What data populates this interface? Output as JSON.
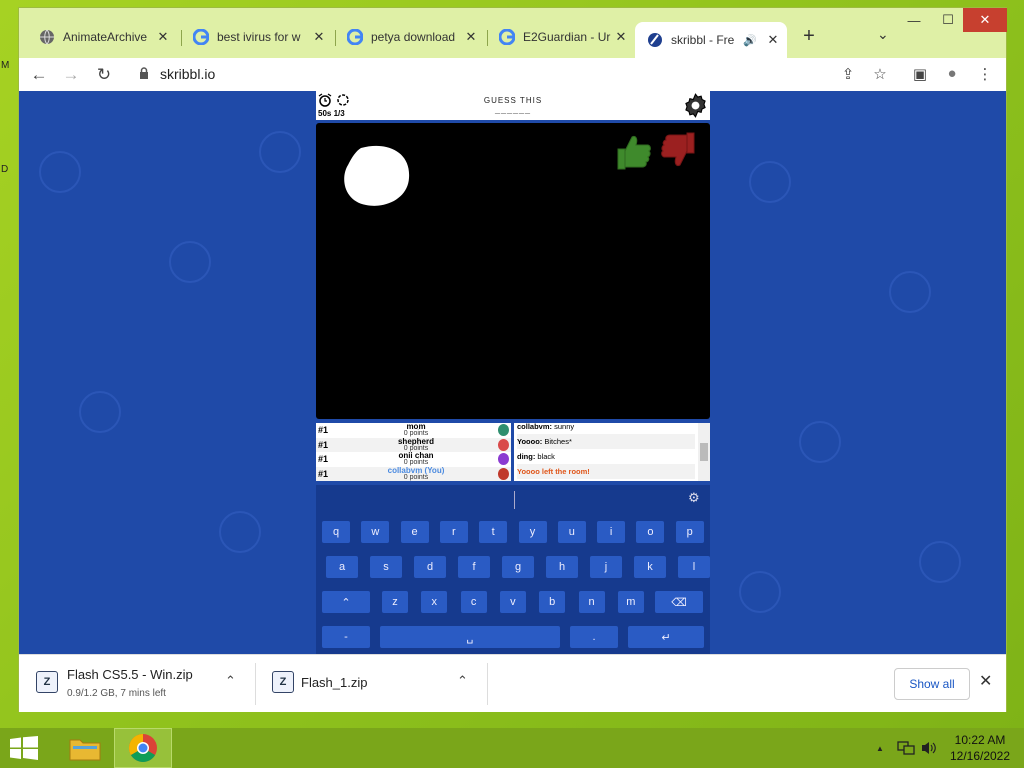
{
  "desktop": {
    "marks": [
      "M",
      "D"
    ]
  },
  "browser": {
    "tabs": [
      {
        "label": "AnimateArchive",
        "icon": "globe-icon",
        "close": "✕"
      },
      {
        "label": "best ivirus for w",
        "icon": "google-icon",
        "close": "✕"
      },
      {
        "label": "petya download",
        "icon": "google-icon",
        "close": "✕"
      },
      {
        "label": "E2Guardian - Ur",
        "icon": "google-icon",
        "close": "✕"
      },
      {
        "label": "skribbl - Fre",
        "icon": "skribbl-icon",
        "close": "✕",
        "active": true
      }
    ],
    "new_tab": "+",
    "tab_search": "⌄",
    "window_controls": {
      "minimize": "—",
      "maximize": "☐",
      "close": "✕"
    },
    "nav": {
      "back": "←",
      "forward": "→",
      "reload": "↻"
    },
    "address": "skribbl.io",
    "toolbar_icons": {
      "share": "⇪",
      "bookmark": "☆",
      "sidepanel": "▣",
      "profile": "●",
      "menu": "⋮"
    }
  },
  "game": {
    "timer": "50s 1/3",
    "guess_label": "GUESS THIS",
    "guess_word": "______",
    "players": [
      {
        "rank": "#1",
        "name": "mom",
        "points": "0 points",
        "color": "#000000",
        "avatar": "#2f8f6f"
      },
      {
        "rank": "#1",
        "name": "shepherd",
        "points": "0 points",
        "color": "#000000",
        "avatar": "#d94a4a"
      },
      {
        "rank": "#1",
        "name": "onii chan",
        "points": "0 points",
        "color": "#000000",
        "avatar": "#8b3bd1"
      },
      {
        "rank": "#1",
        "name": "collabvm (You)",
        "points": "0 points",
        "color": "#4a8ae0",
        "avatar": "#c0392b"
      }
    ],
    "chat": [
      {
        "user": "collabvm:",
        "text": " sunny"
      },
      {
        "user": "Yoooo:",
        "text": " Bitches*"
      },
      {
        "user": "ding:",
        "text": " black"
      },
      {
        "system": "Yoooo left the room!"
      }
    ],
    "keyboard": {
      "row1": [
        "q",
        "w",
        "e",
        "r",
        "t",
        "y",
        "u",
        "i",
        "o",
        "p"
      ],
      "row2": [
        "a",
        "s",
        "d",
        "f",
        "g",
        "h",
        "j",
        "k",
        "l"
      ],
      "row3": [
        "⌃",
        "z",
        "x",
        "c",
        "v",
        "b",
        "n",
        "m",
        "⌫"
      ],
      "row4": [
        "-",
        "␣",
        ".",
        "↵"
      ]
    }
  },
  "downloads": {
    "items": [
      {
        "name": "Flash CS5.5 - Win.zip",
        "status": "0.9/1.2 GB, 7 mins left"
      },
      {
        "name": "Flash_1.zip",
        "status": ""
      }
    ],
    "show_all": "Show all",
    "close": "✕",
    "chevron": "⌃"
  },
  "taskbar": {
    "time": "10:22 AM",
    "date": "12/16/2022",
    "tray_chevron": "▲"
  }
}
